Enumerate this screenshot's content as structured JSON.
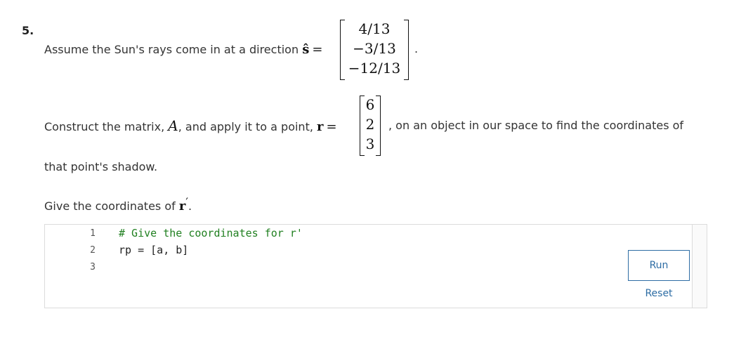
{
  "question": {
    "number": "5.",
    "line1": {
      "text": "Assume the Sun's rays come in at a direction",
      "symbol": "ŝ",
      "equals": "=",
      "vector": [
        "4/13",
        "−3/13",
        "−12/13"
      ],
      "trailing": "."
    },
    "line2": {
      "text_before": "Construct the matrix,",
      "matrix_symbol": "A",
      "text_mid": ", and apply it to a point,",
      "point_symbol": "r",
      "equals": "=",
      "vector": [
        "6",
        "2",
        "3"
      ],
      "text_after": ", on an object in our space to find the coordinates of"
    },
    "line3": "that point's shadow.",
    "line4": {
      "text": "Give the coordinates of",
      "symbol": "r",
      "prime": "′",
      "trailing": "."
    }
  },
  "editor": {
    "line_numbers": [
      "1",
      "2",
      "3"
    ],
    "lines": [
      "# Give the coordinates for r'",
      "rp = [a, b]",
      ""
    ],
    "run_label": "Run",
    "reset_label": "Reset"
  }
}
